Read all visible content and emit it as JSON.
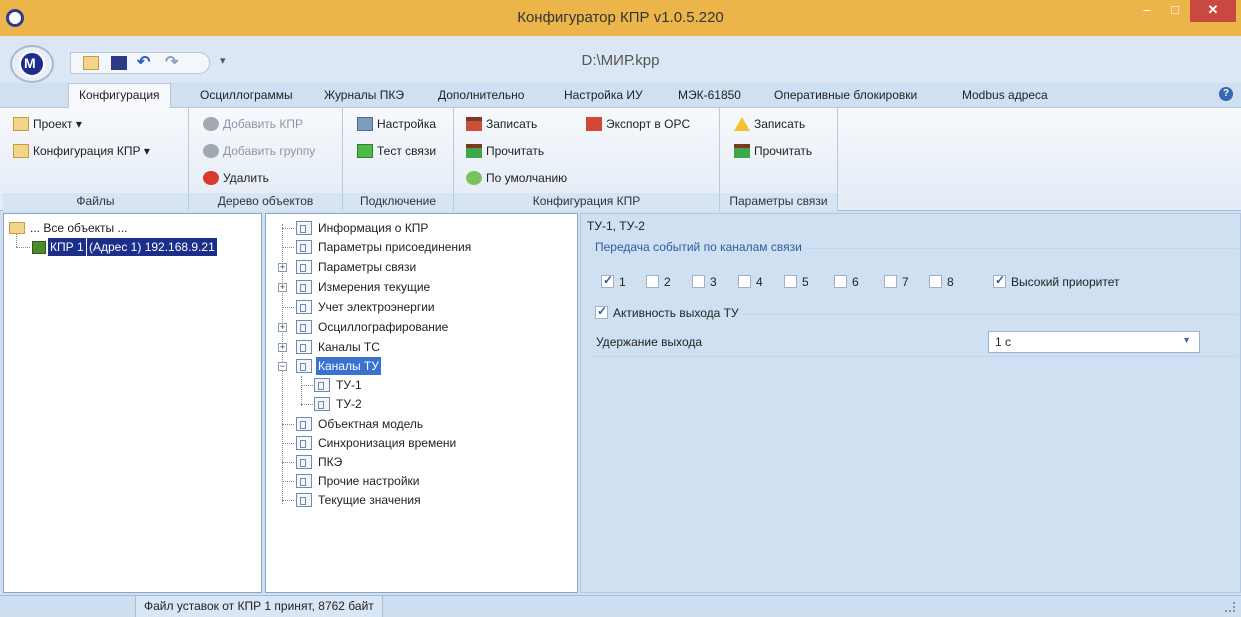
{
  "window": {
    "title": "Конфигуратор КПР v1.0.5.220",
    "document": "D:\\МИР.kpp",
    "minimize": "–",
    "maximize": "□",
    "close": "✕"
  },
  "qat": {
    "dropdown": "▾"
  },
  "help": "?",
  "tabs": [
    "Конфигурация",
    "Осциллограммы",
    "Журналы ПКЭ",
    "Дополнительно",
    "Настройка ИУ",
    "МЭК-61850",
    "Оперативные блокировки",
    "Modbus адреса"
  ],
  "ribbon": {
    "files": {
      "label": "Файлы",
      "project": "Проект ▾",
      "kpr_config": "Конфигурация КПР ▾"
    },
    "tree": {
      "label": "Дерево объектов",
      "add_kpr": "Добавить КПР",
      "add_group": "Добавить группу",
      "delete": "Удалить"
    },
    "connection": {
      "label": "Подключение",
      "settings": "Настройка",
      "test": "Тест связи"
    },
    "kpr_config": {
      "label": "Конфигурация КПР",
      "write": "Записать",
      "read": "Прочитать",
      "default": "По умолчанию",
      "export_opc": "Экспорт в OPC"
    },
    "comm_params": {
      "label": "Параметры связи",
      "write": "Записать",
      "read": "Прочитать"
    }
  },
  "object_tree": {
    "root": "... Все объекты ...",
    "kpr_name": "КПР 1",
    "kpr_addr": "(Адрес 1) 192.168.9.21"
  },
  "nav_tree": [
    "Информация о КПР",
    "Параметры присоединения",
    "Параметры связи",
    "Измерения текущие",
    "Учет электроэнергии",
    "Осциллографирование",
    "Каналы ТС",
    "Каналы ТУ",
    "ТУ-1",
    "ТУ-2",
    "Объектная модель",
    "Синхронизация времени",
    "ПКЭ",
    "Прочие настройки",
    "Текущие значения"
  ],
  "props": {
    "header": "ТУ-1, ТУ-2",
    "events_group": "Передача событий по каналам связи",
    "channels": [
      "1",
      "2",
      "3",
      "4",
      "5",
      "6",
      "7",
      "8"
    ],
    "channels_checked": [
      true,
      false,
      false,
      false,
      false,
      false,
      false,
      false
    ],
    "high_priority": "Высокий приоритет",
    "high_priority_checked": true,
    "output_active": "Активность выхода ТУ",
    "output_active_checked": true,
    "hold_label": "Удержание выхода",
    "hold_value": "1 с"
  },
  "status": {
    "text": "Файл уставок от КПР 1 принят, 8762 байт"
  }
}
